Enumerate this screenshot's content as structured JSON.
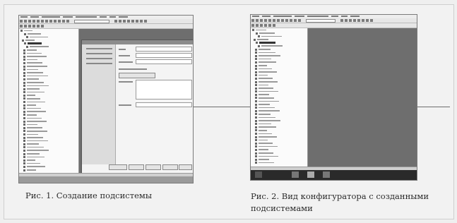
{
  "figures": [
    {
      "caption": "Рис. 1. Создание подсистемы",
      "screenshot": "1C configurator window with subsystem creation dialog",
      "colors": {
        "tree_bg": "#fbfbfb",
        "workspace": "#6e6e6e",
        "dialog": "#f4f4f4"
      }
    },
    {
      "caption": "Рис. 2. Вид конфигуратора с созданными подсистемами",
      "screenshot": "1C configurator window showing created subsystems",
      "colors": {
        "tree_bg": "#fbfbfb",
        "workspace": "#6e6e6e",
        "taskbar": "#2a2a2a"
      }
    }
  ]
}
